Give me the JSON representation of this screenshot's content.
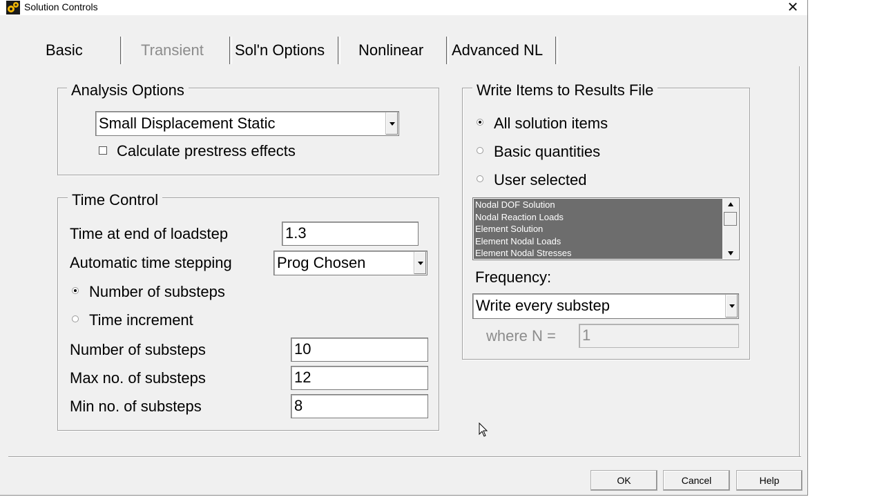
{
  "window": {
    "title": "Solution Controls",
    "close_icon": "close-icon"
  },
  "tabs": [
    {
      "label": "Basic",
      "active": true,
      "enabled": true
    },
    {
      "label": "Transient",
      "active": false,
      "enabled": false
    },
    {
      "label": "Sol'n Options",
      "active": false,
      "enabled": true
    },
    {
      "label": "Nonlinear",
      "active": false,
      "enabled": true
    },
    {
      "label": "Advanced NL",
      "active": false,
      "enabled": true
    }
  ],
  "analysis_options": {
    "legend": "Analysis Options",
    "type_value": "Small Displacement Static",
    "prestress_label": "Calculate prestress effects",
    "prestress_checked": false
  },
  "time_control": {
    "legend": "Time Control",
    "time_end_label": "Time at end of loadstep",
    "time_end_value": "1.3",
    "auto_step_label": "Automatic time stepping",
    "auto_step_value": "Prog Chosen",
    "radio_substeps_label": "Number of substeps",
    "radio_time_inc_label": "Time increment",
    "num_substeps_label": "Number of substeps",
    "num_substeps_value": "10",
    "max_substeps_label": "Max no. of substeps",
    "max_substeps_value": "12",
    "min_substeps_label": "Min no. of substeps",
    "min_substeps_value": "8"
  },
  "results_file": {
    "legend": "Write Items to Results File",
    "radio_all": "All solution items",
    "radio_basic": "Basic quantities",
    "radio_user": "User selected",
    "items": [
      "Nodal DOF Solution",
      "Nodal Reaction Loads",
      "Element Solution",
      "Element Nodal Loads",
      "Element Nodal Stresses"
    ],
    "frequency_label": "Frequency:",
    "frequency_value": "Write every substep",
    "where_n_label": "where N =",
    "where_n_value": "1"
  },
  "buttons": {
    "ok": "OK",
    "cancel": "Cancel",
    "help": "Help"
  },
  "colors": {
    "dialog_bg": "#f0f0f0",
    "list_bg": "#6d6d6d",
    "disabled_text": "#8c8c8c"
  }
}
